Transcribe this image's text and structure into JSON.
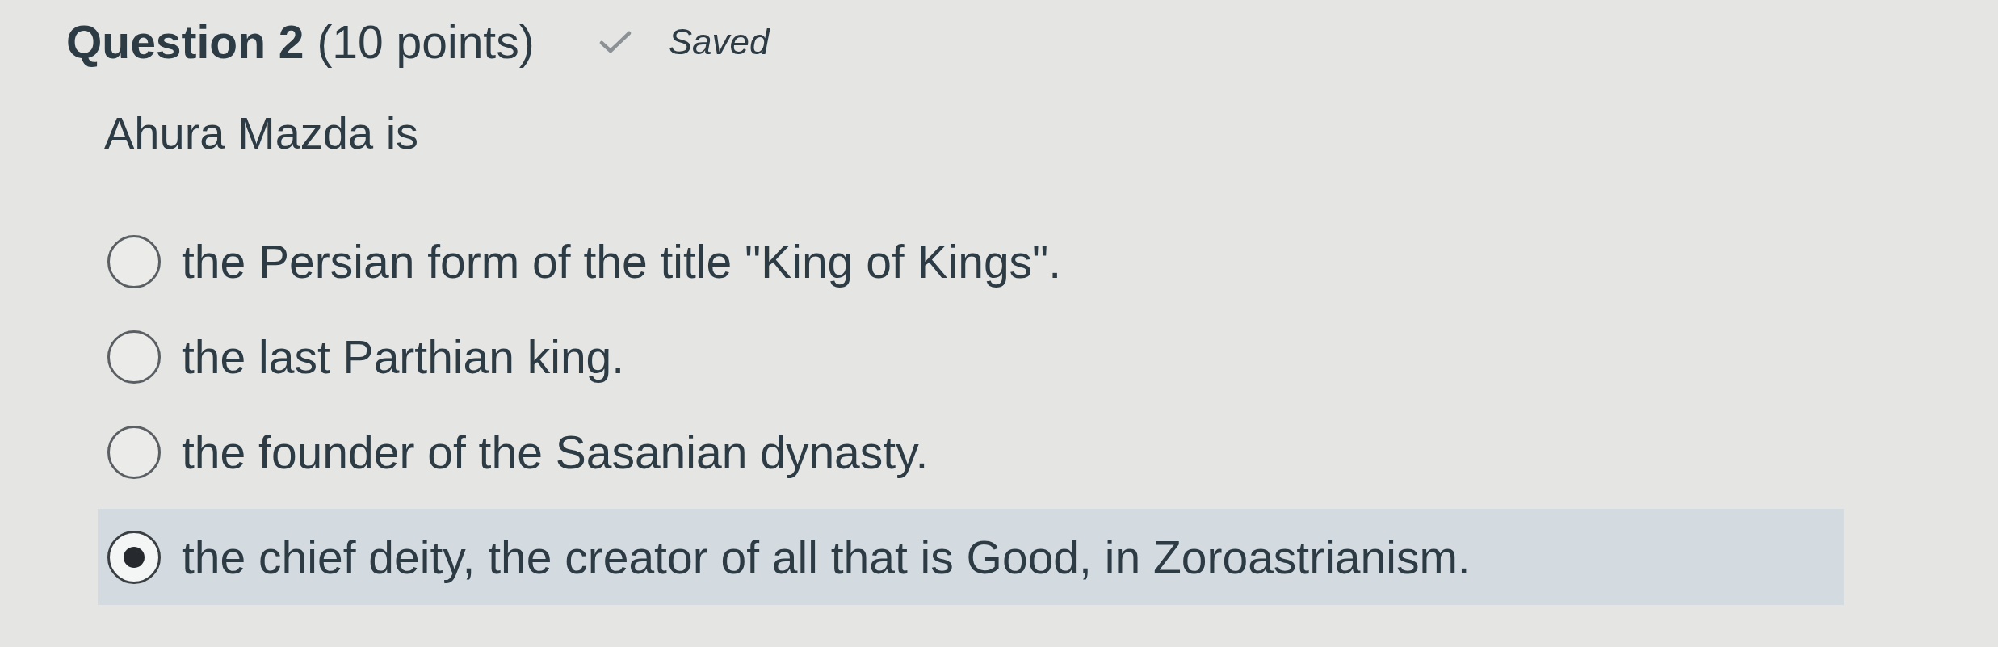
{
  "question": {
    "title": "**Question 2** (10 points)",
    "save_status": "Saved",
    "prompt": "Ahura Mazda is",
    "options": [
      {
        "label": "the Persian form of the title \"King of Kings\".",
        "selected": false
      },
      {
        "label": "the last Parthian king.",
        "selected": false
      },
      {
        "label": "the founder of the Sasanian dynasty.",
        "selected": false
      },
      {
        "label": "the chief deity, the creator of all that is Good, in Zoroastrianism.",
        "selected": true
      }
    ]
  }
}
